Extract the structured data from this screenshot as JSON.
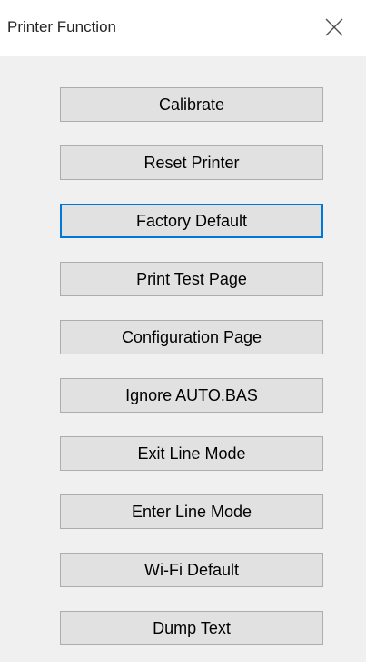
{
  "window": {
    "title": "Printer Function",
    "close_icon": "close-icon"
  },
  "buttons": [
    {
      "label": "Calibrate",
      "focused": false
    },
    {
      "label": "Reset Printer",
      "focused": false
    },
    {
      "label": "Factory Default",
      "focused": true
    },
    {
      "label": "Print Test Page",
      "focused": false
    },
    {
      "label": "Configuration Page",
      "focused": false
    },
    {
      "label": "Ignore AUTO.BAS",
      "focused": false
    },
    {
      "label": "Exit Line Mode",
      "focused": false
    },
    {
      "label": "Enter Line Mode",
      "focused": false
    },
    {
      "label": "Wi-Fi Default",
      "focused": false
    },
    {
      "label": "Dump Text",
      "focused": false
    }
  ],
  "colors": {
    "focus_border": "#0078d7",
    "button_face": "#e1e1e1",
    "window_background": "#f0f0f0"
  }
}
